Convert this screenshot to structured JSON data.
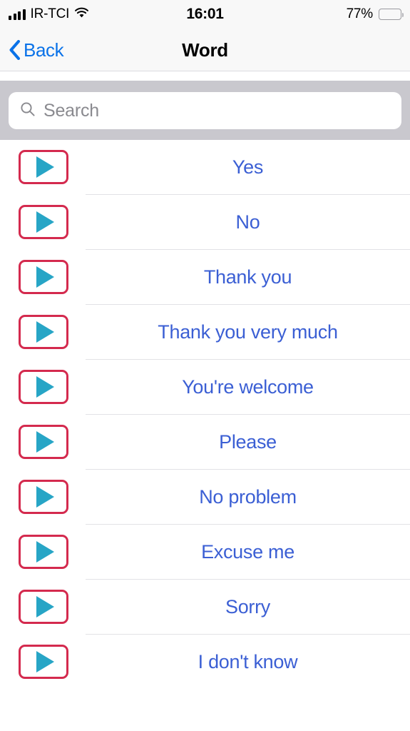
{
  "status_bar": {
    "carrier": "IR-TCI",
    "signal_bars": 4,
    "wifi_icon": "wifi-icon",
    "time": "16:01",
    "battery_percent": "77%",
    "battery_icon": "battery-icon"
  },
  "nav_bar": {
    "back_label": "Back",
    "back_icon": "chevron-left-icon",
    "title": "Word"
  },
  "search": {
    "placeholder": "Search",
    "value": "",
    "icon": "search-icon"
  },
  "colors": {
    "ios_blue": "#0a72e8",
    "row_text_blue": "#3b5fd4",
    "play_border_red": "#d42a4e",
    "play_triangle_teal": "#27a5c6",
    "search_bar_gray": "#c9c8ce",
    "nav_bg": "#f8f8f8",
    "separator": "#e2e2e6"
  },
  "list": {
    "play_icon": "play-icon",
    "items": [
      {
        "label": "Yes"
      },
      {
        "label": "No"
      },
      {
        "label": "Thank you"
      },
      {
        "label": "Thank you very much"
      },
      {
        "label": "You're welcome"
      },
      {
        "label": "Please"
      },
      {
        "label": "No problem"
      },
      {
        "label": "Excuse me"
      },
      {
        "label": "Sorry"
      },
      {
        "label": "I don't know"
      }
    ]
  }
}
